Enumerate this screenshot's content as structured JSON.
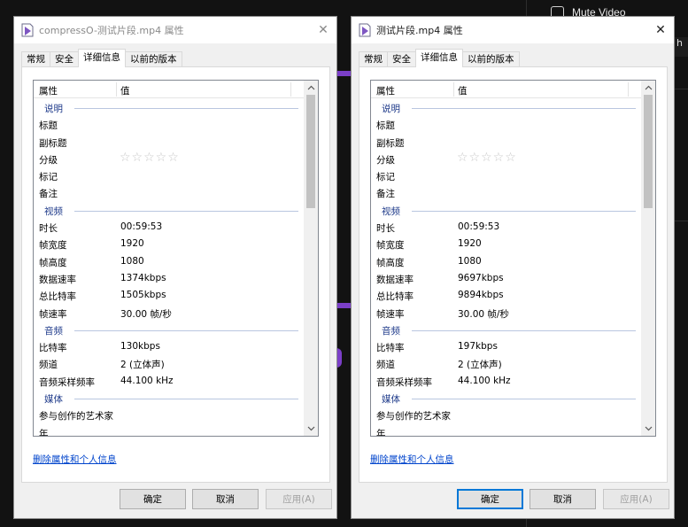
{
  "background": {
    "mute_label": "Mute Video",
    "tail_text": "h",
    "accent": "#7b3fc8"
  },
  "dialog1": {
    "title": "compressO-测试片段.mp4 属性",
    "tabs": [
      "常规",
      "安全",
      "详细信息",
      "以前的版本"
    ],
    "active_tab": "详细信息",
    "header": {
      "col1": "属性",
      "col2": "值"
    },
    "rows": [
      {
        "type": "group",
        "label": "说明"
      },
      {
        "type": "prop",
        "key": "标题",
        "value": ""
      },
      {
        "type": "prop",
        "key": "副标题",
        "value": ""
      },
      {
        "type": "rating",
        "key": "分级",
        "value": "☆☆☆☆☆"
      },
      {
        "type": "prop",
        "key": "标记",
        "value": ""
      },
      {
        "type": "prop",
        "key": "备注",
        "value": ""
      },
      {
        "type": "group",
        "label": "视频"
      },
      {
        "type": "prop",
        "key": "时长",
        "value": "00:59:53"
      },
      {
        "type": "prop",
        "key": "帧宽度",
        "value": "1920"
      },
      {
        "type": "prop",
        "key": "帧高度",
        "value": "1080"
      },
      {
        "type": "prop",
        "key": "数据速率",
        "value": "1374kbps"
      },
      {
        "type": "prop",
        "key": "总比特率",
        "value": "1505kbps"
      },
      {
        "type": "prop",
        "key": "帧速率",
        "value": "30.00 帧/秒"
      },
      {
        "type": "group",
        "label": "音频"
      },
      {
        "type": "prop",
        "key": "比特率",
        "value": "130kbps"
      },
      {
        "type": "prop",
        "key": "频道",
        "value": "2 (立体声)"
      },
      {
        "type": "prop",
        "key": "音频采样频率",
        "value": "44.100 kHz"
      },
      {
        "type": "group",
        "label": "媒体"
      },
      {
        "type": "prop",
        "key": "参与创作的艺术家",
        "value": ""
      },
      {
        "type": "prop",
        "key": "年",
        "value": ""
      }
    ],
    "link": "删除属性和个人信息",
    "buttons": {
      "ok": "确定",
      "cancel": "取消",
      "apply": "应用(A)"
    }
  },
  "dialog2": {
    "title": "测试片段.mp4 属性",
    "tabs": [
      "常规",
      "安全",
      "详细信息",
      "以前的版本"
    ],
    "active_tab": "详细信息",
    "header": {
      "col1": "属性",
      "col2": "值"
    },
    "rows": [
      {
        "type": "group",
        "label": "说明"
      },
      {
        "type": "prop",
        "key": "标题",
        "value": ""
      },
      {
        "type": "prop",
        "key": "副标题",
        "value": ""
      },
      {
        "type": "rating",
        "key": "分级",
        "value": "☆☆☆☆☆"
      },
      {
        "type": "prop",
        "key": "标记",
        "value": ""
      },
      {
        "type": "prop",
        "key": "备注",
        "value": ""
      },
      {
        "type": "group",
        "label": "视频"
      },
      {
        "type": "prop",
        "key": "时长",
        "value": "00:59:53"
      },
      {
        "type": "prop",
        "key": "帧宽度",
        "value": "1920"
      },
      {
        "type": "prop",
        "key": "帧高度",
        "value": "1080"
      },
      {
        "type": "prop",
        "key": "数据速率",
        "value": "9697kbps"
      },
      {
        "type": "prop",
        "key": "总比特率",
        "value": "9894kbps"
      },
      {
        "type": "prop",
        "key": "帧速率",
        "value": "30.00 帧/秒"
      },
      {
        "type": "group",
        "label": "音频"
      },
      {
        "type": "prop",
        "key": "比特率",
        "value": "197kbps"
      },
      {
        "type": "prop",
        "key": "频道",
        "value": "2 (立体声)"
      },
      {
        "type": "prop",
        "key": "音频采样频率",
        "value": "44.100 kHz"
      },
      {
        "type": "group",
        "label": "媒体"
      },
      {
        "type": "prop",
        "key": "参与创作的艺术家",
        "value": ""
      },
      {
        "type": "prop",
        "key": "年",
        "value": ""
      }
    ],
    "link": "删除属性和个人信息",
    "buttons": {
      "ok": "确定",
      "cancel": "取消",
      "apply": "应用(A)"
    }
  }
}
